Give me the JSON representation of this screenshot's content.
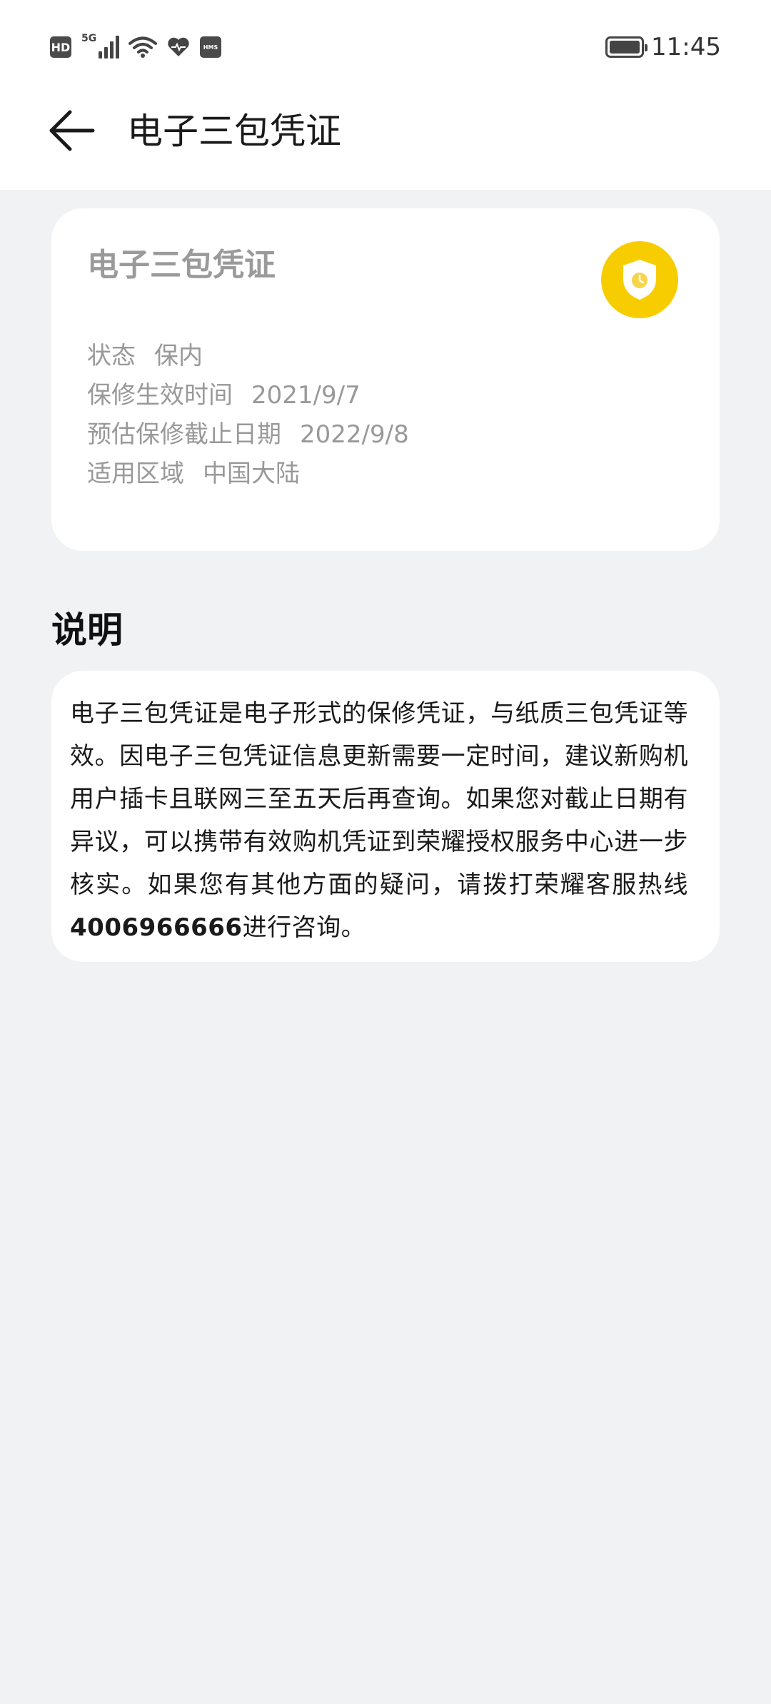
{
  "status_bar": {
    "hd_label": "HD",
    "network_label": "5G",
    "hms_label": "HMS",
    "time": "11:45"
  },
  "header": {
    "title": "电子三包凭证"
  },
  "warranty_card": {
    "title": "电子三包凭证",
    "rows": [
      {
        "label": "状态",
        "value": "保内"
      },
      {
        "label": "保修生效时间",
        "value": "2021/9/7"
      },
      {
        "label": "预估保修截止日期",
        "value": "2022/9/8"
      },
      {
        "label": "适用区域",
        "value": "中国大陆"
      }
    ],
    "badge_color": "#f7cd00"
  },
  "description": {
    "section_title": "说明",
    "text_before": "电子三包凭证是电子形式的保修凭证，与纸质三包凭证等效。因电子三包凭证信息更新需要一定时间，建议新购机用户插卡且联网三至五天后再查询。如果您对截止日期有异议，可以携带有效购机凭证到荣耀授权服务中心进一步核实。如果您有其他方面的疑问，请拨打荣耀客服热线",
    "hotline": "4006966666",
    "text_after": "进行咨询。"
  }
}
